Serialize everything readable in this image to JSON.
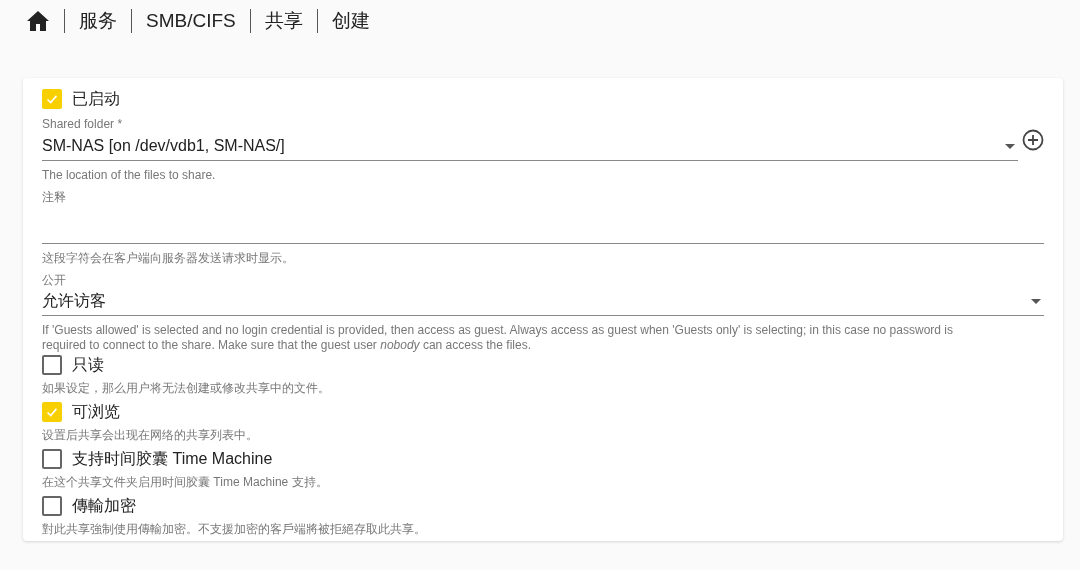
{
  "breadcrumb": [
    "服务",
    "SMB/CIFS",
    "共享",
    "创建"
  ],
  "form": {
    "items": [
      {
        "kind": "checkbox",
        "label": "已启动",
        "checked": true
      },
      {
        "kind": "select",
        "label": "Shared folder *",
        "value": "SM-NAS [on /dev/vdb1, SM-NAS/]",
        "hint": "The location of the files to share.",
        "add_button": true
      },
      {
        "kind": "text",
        "label": "注释",
        "hint": "这段字符会在客户端向服务器发送请求时显示。"
      },
      {
        "kind": "select",
        "label": "公开",
        "value": "允许访客",
        "hint": "If 'Guests allowed' is selected and no login credential is provided, then access as guest. Always access as guest when 'Guests only' is selecting; in this case no password is required to connect to the share. Make sure that the guest user *nobody* can access the files.",
        "add_button": false
      },
      {
        "kind": "checkbox",
        "label": "只读",
        "checked": false,
        "hint": "如果设定，那么用户将无法创建或修改共享中的文件。"
      },
      {
        "kind": "checkbox",
        "label": "可浏览",
        "checked": true,
        "hint": "设置后共享会出现在网络的共享列表中。"
      },
      {
        "kind": "checkbox",
        "label": "支持时间胶囊 Time Machine",
        "checked": false,
        "hint": "在这个共享文件夹启用时间胶囊 Time Machine 支持。"
      },
      {
        "kind": "checkbox",
        "label": "傳輸加密",
        "checked": false,
        "hint": "對此共享強制使用傳輸加密。不支援加密的客戶端將被拒絕存取此共享。"
      }
    ]
  }
}
